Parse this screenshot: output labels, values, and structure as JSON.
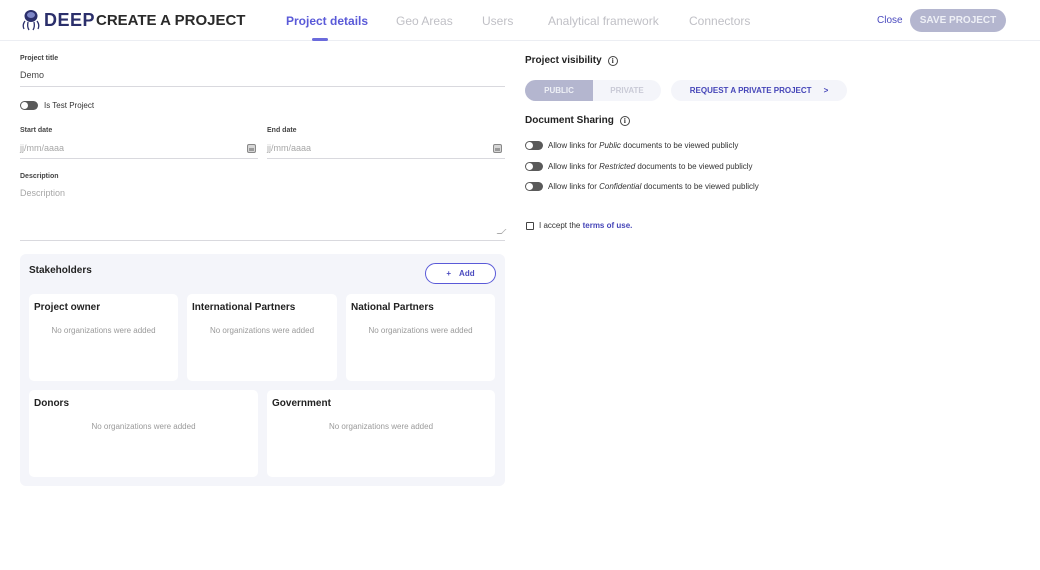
{
  "header": {
    "logo_text": "DEEP",
    "page_title": "CREATE A PROJECT",
    "tabs": [
      {
        "label": "Project details",
        "active": true
      },
      {
        "label": "Geo Areas",
        "active": false
      },
      {
        "label": "Users",
        "active": false
      },
      {
        "label": "Analytical framework",
        "active": false
      },
      {
        "label": "Connectors",
        "active": false
      }
    ],
    "close_label": "Close",
    "save_label": "SAVE PROJECT"
  },
  "form": {
    "title_label": "Project title",
    "title_value": "Demo",
    "test_project_label": "Is Test Project",
    "test_project_enabled": false,
    "start_date_label": "Start date",
    "start_date_placeholder": "jj/mm/aaaa",
    "end_date_label": "End date",
    "end_date_placeholder": "jj/mm/aaaa",
    "description_label": "Description",
    "description_placeholder": "Description"
  },
  "stakeholders": {
    "title": "Stakeholders",
    "add_label": "Add",
    "add_icon": "plus-icon",
    "groups": [
      {
        "name": "Project owner",
        "empty_text": "No organizations were added"
      },
      {
        "name": "International Partners",
        "empty_text": "No organizations were added"
      },
      {
        "name": "National Partners",
        "empty_text": "No organizations were added"
      },
      {
        "name": "Donors",
        "empty_text": "No organizations were added"
      },
      {
        "name": "Government",
        "empty_text": "No organizations were added"
      }
    ]
  },
  "visibility": {
    "title": "Project visibility",
    "info_icon": "info-icon",
    "options": [
      {
        "label": "PUBLIC",
        "selected": true
      },
      {
        "label": "PRIVATE",
        "selected": false
      }
    ],
    "request_private_label": "REQUEST A PRIVATE PROJECT",
    "request_private_icon": "chevron-right-icon"
  },
  "sharing": {
    "title": "Document Sharing",
    "info_icon": "info-icon",
    "toggles": [
      {
        "prefix": "Allow links for ",
        "level": "Public",
        "suffix": " documents to be viewed publicly",
        "enabled": false
      },
      {
        "prefix": "Allow links for ",
        "level": "Restricted",
        "suffix": " documents to be viewed publicly",
        "enabled": false
      },
      {
        "prefix": "Allow links for ",
        "level": "Confidential",
        "suffix": " documents to be viewed publicly",
        "enabled": false
      }
    ]
  },
  "terms": {
    "prefix": "I accept the ",
    "link_text": "terms of use.",
    "checked": false
  },
  "colors": {
    "accent": "#5a5ad8",
    "brand": "#2b2f6b",
    "disabled_button": "#b4b6cf",
    "panel_bg": "#f4f5fa"
  }
}
